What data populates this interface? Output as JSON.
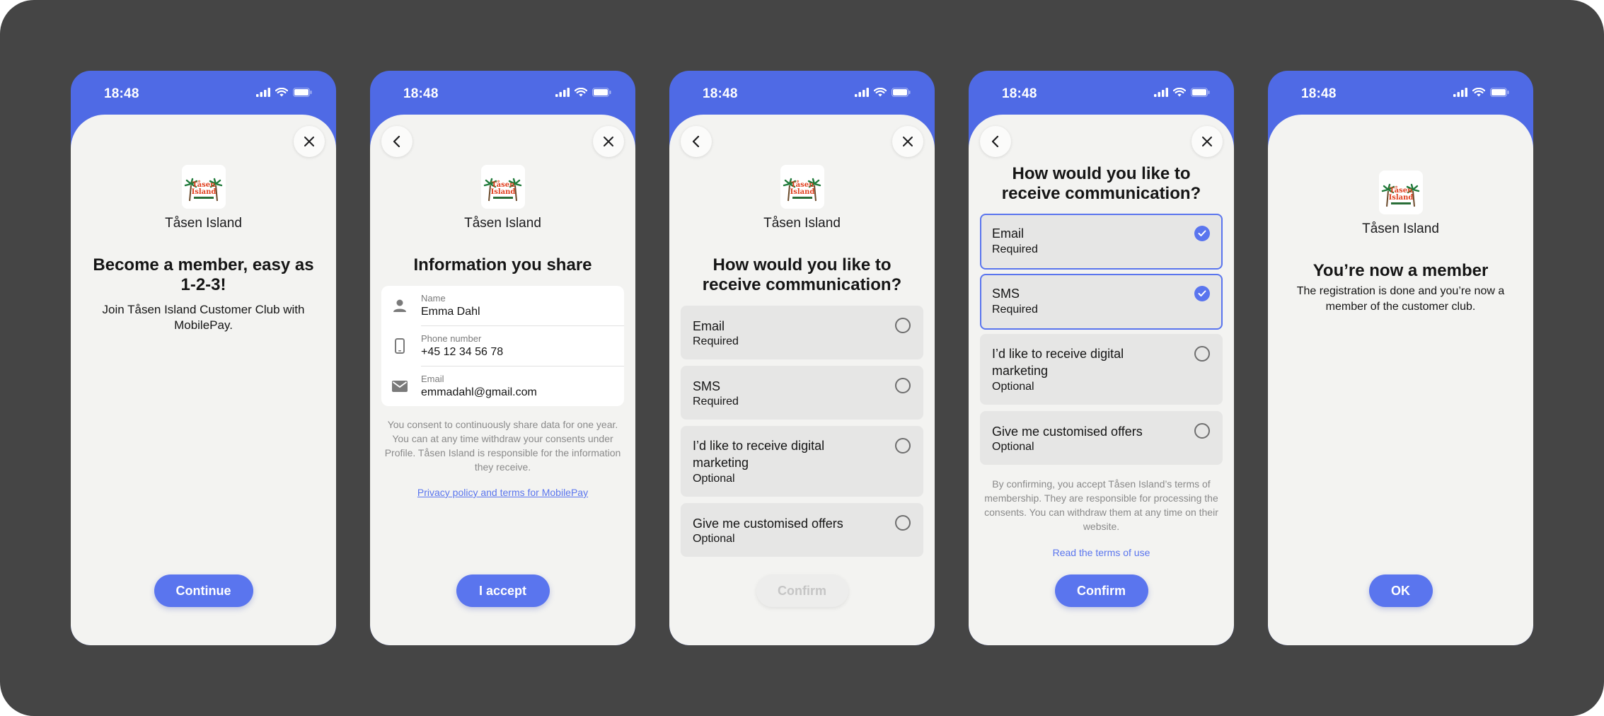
{
  "common": {
    "time": "18:48",
    "brand_name": "Tåsen Island",
    "logo_text_line1": "Tåsen",
    "logo_text_line2": "Island"
  },
  "screen1": {
    "title": "Become a member, easy as 1-2-3!",
    "description": "Join Tåsen Island Customer Club with MobilePay.",
    "button_label": "Continue"
  },
  "screen2": {
    "title": "Information you share",
    "fields": [
      {
        "label": "Name",
        "value": "Emma Dahl",
        "icon": "person-icon"
      },
      {
        "label": "Phone number",
        "value": "+45 12 34 56 78",
        "icon": "phone-icon"
      },
      {
        "label": "Email",
        "value": "emmadahl@gmail.com",
        "icon": "mail-icon"
      }
    ],
    "consent_text": "You consent to continuously share data for one year. You can at any time withdraw your consents under Profile. Tåsen Island is responsible for the information they receive.",
    "policy_link": "Privacy policy and terms for MobilePay",
    "button_label": "I accept"
  },
  "screen3": {
    "title": "How would you like to receive communication?",
    "options": [
      {
        "title": "Email",
        "subtitle": "Required",
        "checked": false
      },
      {
        "title": "SMS",
        "subtitle": "Required",
        "checked": false
      },
      {
        "title": "I’d like to receive digital marketing",
        "subtitle": "Optional",
        "checked": false
      },
      {
        "title": "Give me customised offers",
        "subtitle": "Optional",
        "checked": false
      }
    ],
    "button_label": "Confirm",
    "button_state": "disabled"
  },
  "screen4": {
    "title": "How would you like to receive communication?",
    "options": [
      {
        "title": "Email",
        "subtitle": "Required",
        "checked": true
      },
      {
        "title": "SMS",
        "subtitle": "Required",
        "checked": true
      },
      {
        "title": "I’d like to receive digital marketing",
        "subtitle": "Optional",
        "checked": false
      },
      {
        "title": "Give me customised offers",
        "subtitle": "Optional",
        "checked": false
      }
    ],
    "terms_text": "By confirming, you accept Tåsen Island’s terms of membership. They are responsible for processing the consents. You can withdraw them at any time on their website.",
    "terms_link": "Read the terms of use",
    "button_label": "Confirm"
  },
  "screen5": {
    "title": "You’re now a member",
    "description": "The registration is done and you’re now a member of the customer club.",
    "button_label": "OK"
  },
  "colors": {
    "accent": "#5a75ee",
    "header_blue": "#4f6ae5",
    "sheet_bg": "#f3f3f1",
    "option_bg": "#e6e6e5",
    "canvas_bg": "#454545"
  }
}
